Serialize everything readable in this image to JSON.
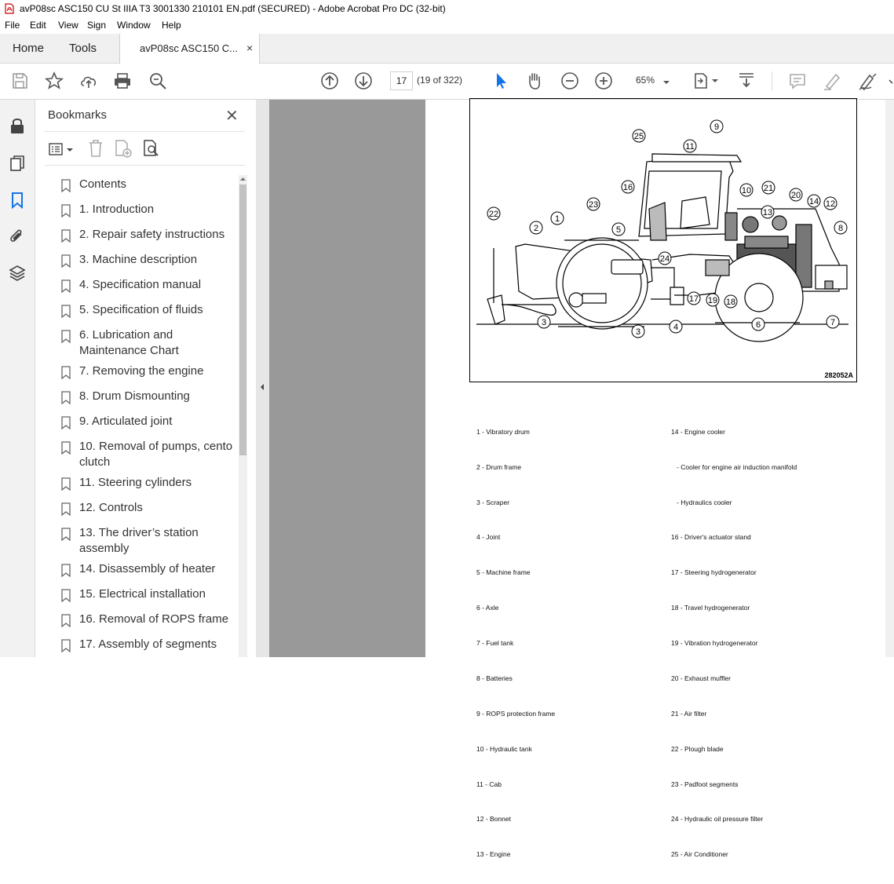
{
  "window": {
    "title": "avP08sc ASC150 CU St IIIA T3 3001330 210101 EN.pdf (SECURED) - Adobe Acrobat Pro DC (32-bit)"
  },
  "menu": [
    "File",
    "Edit",
    "View",
    "Sign",
    "Window",
    "Help"
  ],
  "tabs": {
    "home": "Home",
    "tools": "Tools",
    "document": "avP08sc ASC150 C...",
    "close": "×"
  },
  "toolbar": {
    "page_number": "17",
    "page_count": "(19 of 322)",
    "zoom": "65%"
  },
  "bookmarks": {
    "title": "Bookmarks",
    "close": "✕",
    "items": [
      "Contents",
      "1. Introduction",
      "2. Repair safety instructions",
      "3. Machine description",
      "4. Specification manual",
      "5. Specification of fluids",
      "6. Lubrication and Maintenance Chart",
      "7. Removing the engine",
      "8. Drum Dismounting",
      "9. Articulated joint",
      "10. Removal of pumps, cento clutch",
      "11. Steering cylinders",
      "12. Controls",
      "13. The driver’s station assembly",
      "14. Disassembly of heater",
      "15. Electrical installation",
      "16. Removal of ROPS frame",
      "17. Assembly of segments"
    ]
  },
  "document": {
    "figure_id": "282052A",
    "callouts": [
      "1",
      "2",
      "3",
      "3",
      "4",
      "5",
      "6",
      "7",
      "8",
      "9",
      "10",
      "11",
      "12",
      "13",
      "14",
      "16",
      "17",
      "18",
      "19",
      "20",
      "21",
      "22",
      "23",
      "24",
      "25"
    ],
    "legend_left": [
      "1 - Vibratory drum",
      "2 - Drum frame",
      "3 - Scraper",
      "4 - Joint",
      "5 - Machine frame",
      "6 - Axle",
      "7 - Fuel tank",
      "8 - Batteries",
      "9 - ROPS protection frame",
      "10 - Hydraulic tank",
      "11 - Cab",
      "12 - Bonnet",
      "13 - Engine"
    ],
    "legend_right": [
      "14 - Engine cooler",
      "   - Cooler for engine air induction manifold",
      "   - Hydraulics cooler",
      "16 - Driver's actuator stand",
      "17 - Steering hydrogenerator",
      "18 - Travel hydrogenerator",
      "19 - Vibration hydrogenerator",
      "20 - Exhaust muffler",
      "21 - Air filter",
      "22 - Plough blade",
      "23 - Padfoot segments",
      "24 - Hydraulic oil pressure filter",
      "25 - Air Conditioner"
    ]
  }
}
